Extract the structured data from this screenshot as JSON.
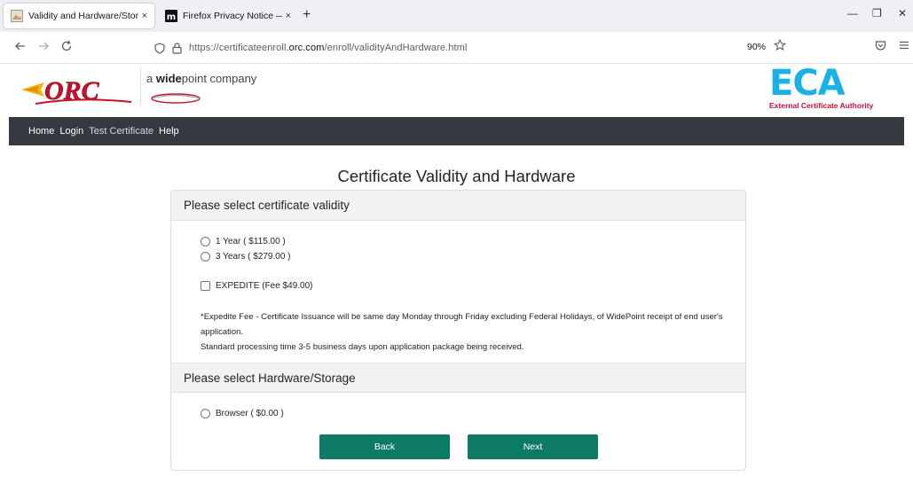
{
  "browser": {
    "tabs": [
      {
        "title": "Validity and Hardware/Storage",
        "close": "×",
        "active": true
      },
      {
        "title": "Firefox Privacy Notice — Mozill",
        "close": "×",
        "active": false
      }
    ],
    "new_tab": "+",
    "window_controls": {
      "minimize": "—",
      "restore": "❐",
      "close": "✕"
    },
    "url": {
      "prefix": "https://certificateenroll.",
      "domain": "orc.com",
      "path": "/enroll/validityAndHardware.html"
    },
    "zoom": "90%"
  },
  "header": {
    "orc_logo_text": "ORC",
    "tagline_prefix": "a ",
    "tagline_bold": "wide",
    "tagline_suffix": "point company",
    "eca_letters": "ECA",
    "eca_sub": "External Certificate Authority"
  },
  "site_nav": [
    {
      "label": "Home"
    },
    {
      "label": "Login"
    },
    {
      "label": "Test Certificate"
    },
    {
      "label": "Help"
    }
  ],
  "page": {
    "title": "Certificate Validity and Hardware"
  },
  "validity": {
    "header": "Please select certificate validity",
    "options": [
      {
        "label": "1 Year ( $115.00 )"
      },
      {
        "label": "3 Years ( $279.00 )"
      }
    ],
    "expedite_label": "EXPEDITE (Fee $49.00)",
    "notes": [
      "*Expedite Fee - Certificate Issuance will be same day Monday through Friday excluding Federal Holidays, of WidePoint receipt of end user's application.",
      "Standard processing time 3-5 business days upon application package being received."
    ]
  },
  "hardware": {
    "header": "Please select Hardware/Storage",
    "options": [
      {
        "label": "Browser ( $0.00 )"
      }
    ]
  },
  "buttons": {
    "back": "Back",
    "next": "Next"
  },
  "colors": {
    "nav_bg": "#343a40",
    "button_bg": "#0d7a66",
    "eca_blue": "#1ab1e6",
    "eca_red": "#c8102e"
  }
}
